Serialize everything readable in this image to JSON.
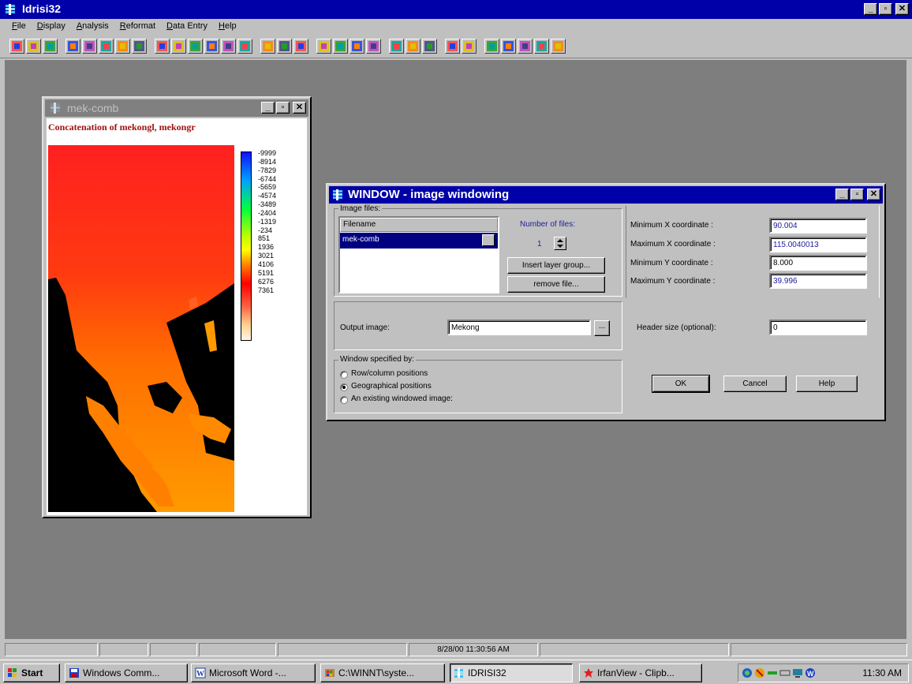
{
  "app": {
    "title": "Idrisi32",
    "menu": [
      "File",
      "Display",
      "Analysis",
      "Reformat",
      "Data Entry",
      "Help"
    ]
  },
  "imageWindow": {
    "title": "mek-comb",
    "caption": "Concatenation of mekongl, mekongr",
    "legend": [
      "-9999",
      "-8914",
      "-7829",
      "-6744",
      "-5659",
      "-4574",
      "-3489",
      "-2404",
      "-1319",
      "-234",
      "851",
      "1936",
      "3021",
      "4106",
      "5191",
      "6276",
      "7361"
    ]
  },
  "dialog": {
    "title": "WINDOW - image windowing",
    "imageFilesLabel": "Image files:",
    "filenameHeader": "Filename",
    "filename": "mek-comb",
    "numberOfFilesLabel": "Number of files:",
    "numberOfFiles": "1",
    "insertLayerGroup": "Insert layer group...",
    "removeFile": "remove file...",
    "outputImageLabel": "Output image:",
    "outputImage": "Mekong",
    "windowSpecifiedBy": "Window specified by:",
    "options": [
      "Row/column positions",
      "Geographical positions",
      "An existing windowed image:"
    ],
    "minXLabel": "Minimum X coordinate :",
    "maxXLabel": "Maximum X coordinate :",
    "minYLabel": "Minimum Y coordinate :",
    "maxYLabel": "Maximum Y coordinate :",
    "minX": "90.004",
    "maxX": "115.0040013",
    "minY": "8.000",
    "maxY": "39.996",
    "headerSizeLabel": "Header size (optional):",
    "headerSize": "0",
    "ok": "OK",
    "cancel": "Cancel",
    "help": "Help"
  },
  "status": {
    "datetime": "8/28/00 11:30:56 AM"
  },
  "taskbar": {
    "start": "Start",
    "tasks": [
      "Windows Comm...",
      "Microsoft Word -...",
      "C:\\WINNT\\syste...",
      "IDRISI32",
      "IrfanView - Clipb..."
    ],
    "clock": "11:30 AM"
  },
  "colors": {
    "titleActive": "#0000a8",
    "desktop": "#7e7e7e",
    "caption": "#a01010"
  }
}
